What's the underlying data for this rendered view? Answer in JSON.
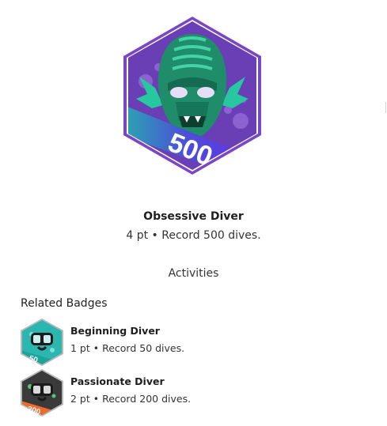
{
  "badge": {
    "name": "Obsessive Diver",
    "description": "4 pt • Record 500 dives.",
    "emblem_number": "500",
    "icon": "sea-creature-badge-icon",
    "colors": {
      "border": "#7b46c2",
      "background": "#6a3fb5",
      "creature": "#1f8c6a",
      "ribbon": "#5b2ae0"
    }
  },
  "activities_label": "Activities",
  "related": {
    "heading": "Related Badges",
    "items": [
      {
        "name": "Beginning Diver",
        "description": "1 pt • Record 50 dives.",
        "emblem_number": "50",
        "icon": "dive-mask-badge-icon",
        "color": "#2bb7b0"
      },
      {
        "name": "Passionate Diver",
        "description": "2 pt • Record 200 dives.",
        "emblem_number": "200",
        "icon": "dive-mask-badge-icon",
        "color": "#3a3a3a"
      }
    ]
  }
}
